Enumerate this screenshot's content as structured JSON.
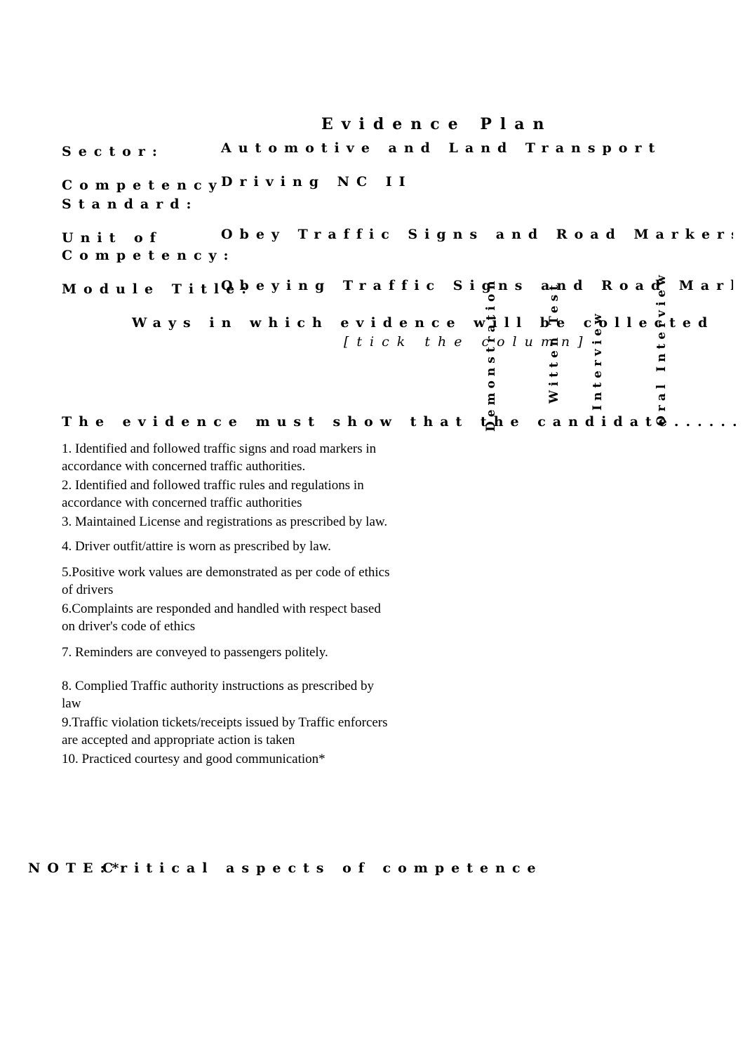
{
  "document": {
    "title": "Evidence Plan",
    "fields": {
      "sector_label": "Sector:",
      "sector_value": "Automotive and Land Transport",
      "competency_standard_label_1": "Competency",
      "competency_standard_label_2": "Standard:",
      "competency_standard_value": "Driving NC II",
      "unit_label_1": "Unit of",
      "unit_label_2": "Competency:",
      "unit_value": "Obey Traffic Signs and Road Markers",
      "module_label": "Module Title:",
      "module_value": "Obeying Traffic Signs and Road Markers"
    },
    "ways_heading": "Ways in which evidence will be collected",
    "ways_subheading": "[tick the column]",
    "methods": [
      "Demonstration",
      "Witten Test",
      "Interview",
      "Oral Interview"
    ],
    "evidence_heading": "The evidence must show that the candidate......",
    "criteria": [
      "1. Identified and followed traffic signs and road markers in accordance with concerned traffic authorities.",
      "2. Identified and followed traffic rules and regulations in accordance with concerned traffic authorities",
      "3. Maintained License and registrations as prescribed by law.",
      "4. Driver outfit/attire is worn as prescribed by law.",
      "5.Positive work values are demonstrated as per code of ethics of drivers",
      "6.Complaints are responded and handled with respect based on driver's code of ethics",
      "7. Reminders are conveyed to passengers politely.",
      "8. Complied Traffic authority instructions as prescribed by law",
      "9.Traffic violation tickets/receipts issued by Traffic enforcers are accepted and appropriate action is taken",
      "10. Practiced courtesy and good communication*"
    ],
    "note_label": "NOTE:*",
    "note_text": "Critical aspects of competence"
  }
}
